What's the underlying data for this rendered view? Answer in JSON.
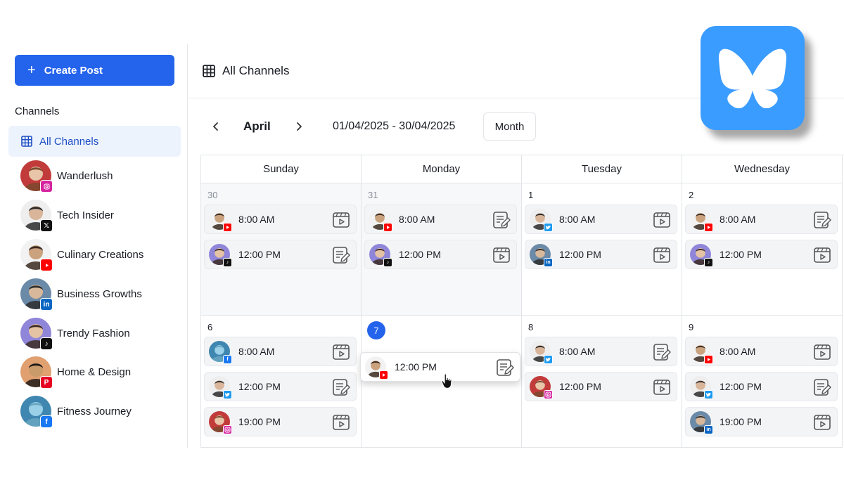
{
  "sidebar": {
    "create_label": "Create Post",
    "channels_label": "Channels",
    "all_channels_label": "All Channels",
    "channels": [
      {
        "name": "Wanderlush",
        "platform": "instagram",
        "badge_color": "#d6249f"
      },
      {
        "name": "Tech Insider",
        "platform": "x",
        "badge_color": "#111111"
      },
      {
        "name": "Culinary Creations",
        "platform": "youtube",
        "badge_color": "#ff0000"
      },
      {
        "name": "Business Growths",
        "platform": "linkedin",
        "badge_color": "#0a66c2"
      },
      {
        "name": "Trendy Fashion",
        "platform": "tiktok",
        "badge_color": "#111111"
      },
      {
        "name": "Home & Design",
        "platform": "pinterest",
        "badge_color": "#e60023"
      },
      {
        "name": "Fitness Journey",
        "platform": "facebook",
        "badge_color": "#1877f2"
      }
    ]
  },
  "header": {
    "title": "All Channels"
  },
  "toolbar": {
    "prev_icon": "chevron-left-icon",
    "next_icon": "chevron-right-icon",
    "month": "April",
    "range": "01/04/2025 - 30/04/2025",
    "view_label": "Month"
  },
  "calendar": {
    "days": [
      "Sunday",
      "Monday",
      "Tuesday",
      "Wednesday"
    ],
    "weeks": [
      {
        "cells": [
          {
            "date": "30",
            "prev_month": true,
            "posts": [
              {
                "time": "8:00 AM",
                "platform": "youtube",
                "type": "video"
              },
              {
                "time": "12:00 PM",
                "platform": "tiktok",
                "type": "text"
              }
            ]
          },
          {
            "date": "31",
            "prev_month": true,
            "posts": [
              {
                "time": "8:00 AM",
                "platform": "youtube",
                "type": "text"
              },
              {
                "time": "12:00 PM",
                "platform": "tiktok",
                "type": "video"
              }
            ]
          },
          {
            "date": "1",
            "prev_month": false,
            "posts": [
              {
                "time": "8:00 AM",
                "platform": "twitter",
                "type": "video"
              },
              {
                "time": "12:00 PM",
                "platform": "linkedin",
                "type": "video"
              }
            ]
          },
          {
            "date": "2",
            "prev_month": false,
            "posts": [
              {
                "time": "8:00 AM",
                "platform": "youtube",
                "type": "text"
              },
              {
                "time": "12:00 PM",
                "platform": "tiktok",
                "type": "video"
              }
            ]
          }
        ]
      },
      {
        "cells": [
          {
            "date": "6",
            "prev_month": false,
            "posts": [
              {
                "time": "8:00 AM",
                "platform": "facebook",
                "type": "video"
              },
              {
                "time": "12:00 PM",
                "platform": "twitter",
                "type": "text"
              },
              {
                "time": "19:00 PM",
                "platform": "instagram",
                "type": "video"
              }
            ]
          },
          {
            "date": "7",
            "today": true,
            "posts": [
              {
                "time": "12:00 PM",
                "platform": "youtube",
                "type": "text",
                "dragging": true
              }
            ]
          },
          {
            "date": "8",
            "prev_month": false,
            "posts": [
              {
                "time": "8:00 AM",
                "platform": "twitter",
                "type": "text"
              },
              {
                "time": "12:00 PM",
                "platform": "instagram",
                "type": "video"
              }
            ]
          },
          {
            "date": "9",
            "prev_month": false,
            "posts": [
              {
                "time": "8:00 AM",
                "platform": "youtube",
                "type": "video"
              },
              {
                "time": "12:00 PM",
                "platform": "twitter",
                "type": "text"
              },
              {
                "time": "19:00 PM",
                "platform": "linkedin",
                "type": "video"
              }
            ]
          }
        ]
      }
    ]
  },
  "platform_colors": {
    "youtube": "#ff0000",
    "tiktok": "#111111",
    "twitter": "#1d9bf0",
    "linkedin": "#0a66c2",
    "facebook": "#1877f2",
    "instagram": "#d6249f",
    "x": "#111111",
    "pinterest": "#e60023"
  },
  "logo": {
    "name": "bluesky-butterfly-icon",
    "color": "#3b9cff"
  }
}
